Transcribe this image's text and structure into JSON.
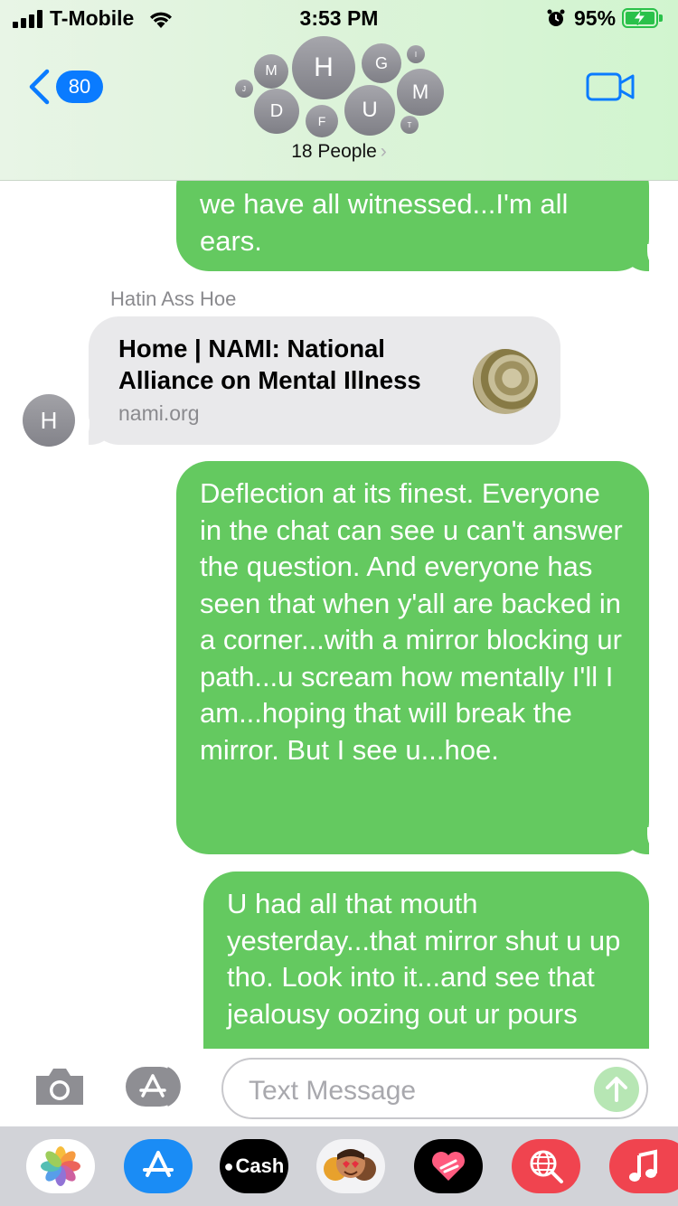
{
  "status_bar": {
    "carrier": "T-Mobile",
    "time": "3:53 PM",
    "battery_percent": "95%"
  },
  "header": {
    "back_count": "80",
    "people_label": "18 People",
    "avatars": [
      "M",
      "H",
      "G",
      "I",
      "J",
      "D",
      "F",
      "U",
      "T",
      "M"
    ]
  },
  "messages": [
    {
      "type": "sent",
      "text": "we have all witnessed...I'm all ears."
    },
    {
      "type": "received_link",
      "sender": "Hatin Ass Hoe",
      "avatar": "H",
      "title": "Home | NAMI: National Alliance on Mental Illness",
      "domain": "nami.org"
    },
    {
      "type": "sent",
      "text": "Deflection at its finest. Everyone in the chat can see u can't answer the question. And everyone has seen that when y'all are backed in a corner...with a mirror blocking ur path...u scream how mentally I'll I am...hoping that will break the mirror. But I see u...hoe."
    },
    {
      "type": "sent",
      "text": "U had all that mouth yesterday...that mirror shut u up tho. Look into it...and see that jealousy oozing out ur pours"
    }
  ],
  "compose": {
    "placeholder": "Text Message"
  },
  "app_drawer": {
    "cash_label": "Cash",
    "apps": [
      "photos-icon",
      "app-store-icon",
      "apple-cash-icon",
      "memoji-icon",
      "heart-app-icon",
      "globe-search-icon",
      "music-icon"
    ]
  },
  "colors": {
    "sent_bubble": "#64c960",
    "received_bubble": "#e9e9eb",
    "accent": "#0a7bff",
    "battery": "#2ac14a"
  }
}
